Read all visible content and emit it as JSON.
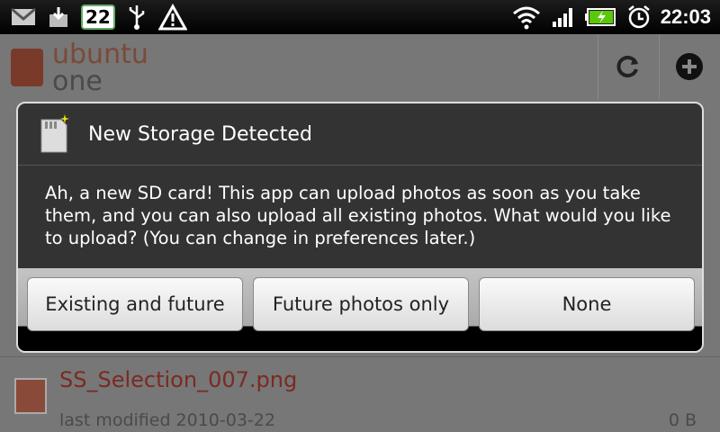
{
  "status_bar": {
    "notification_count": "22",
    "time": "22:03",
    "icons": [
      "gmail-icon",
      "download-icon",
      "notification-count-icon",
      "usb-icon",
      "warning-icon",
      "wifi-icon",
      "signal-icon",
      "battery-charging-icon",
      "alarm-icon"
    ]
  },
  "app": {
    "logo_line1": "ubuntu",
    "logo_line2": "one",
    "header_buttons": [
      "refresh-icon",
      "add-icon"
    ],
    "file_row": {
      "name": "SS_Selection_007.png",
      "modified": "last modified 2010-03-22",
      "size": "0 B"
    }
  },
  "dialog": {
    "title": "New Storage Detected",
    "message": "Ah, a new SD card! This app can upload photos as soon as you take them, and you can also upload all existing photos. What would you like to upload? (You can change in preferences later.)",
    "buttons": {
      "existing_and_future": "Existing and future",
      "future_only": "Future photos only",
      "none": "None"
    }
  },
  "colors": {
    "dialog_bg": "#333333",
    "accent_red": "#7a2a22"
  }
}
